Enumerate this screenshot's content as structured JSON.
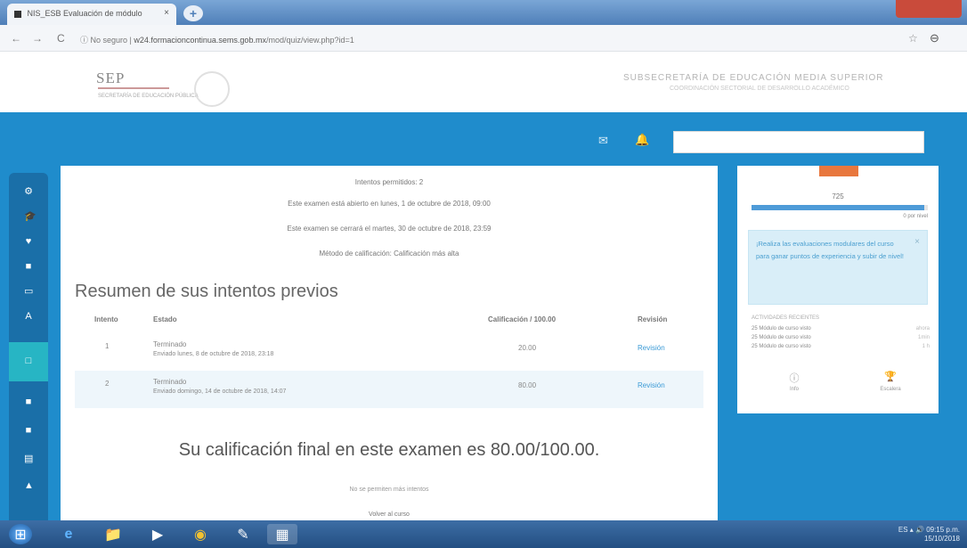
{
  "browser": {
    "tab_title": "NIS_ESB Evaluación de módulo",
    "tab_close": "×",
    "new_tab": "+",
    "back": "←",
    "forward": "→",
    "reload": "C",
    "url_security": "ⓘ No seguro",
    "url_host": "w24.formacioncontinua.sems.gob.mx",
    "url_path": "/mod/quiz/view.php?id=1",
    "star": "☆",
    "account": "⊖"
  },
  "header": {
    "logo_text": "SEP",
    "logo_sub": "SECRETARÍA DE EDUCACIÓN PÚBLICA",
    "title": "SUBSECRETARÍA DE EDUCACIÓN MEDIA SUPERIOR",
    "subtitle": "COORDINACIÓN SECTORIAL DE DESARROLLO ACADÉMICO"
  },
  "navbar": {
    "mail_icon": "✉",
    "bell_icon": "🔔",
    "search_placeholder": ""
  },
  "sidebar": {
    "icons": [
      "⚙",
      "🎓",
      "♥",
      "■",
      "▭",
      "A",
      "□",
      "■",
      "■",
      "▤",
      "▲"
    ]
  },
  "quiz": {
    "attempts_allowed": "Intentos permitidos: 2",
    "opened": "Este examen está abierto en lunes, 1 de octubre de 2018, 09:00",
    "closes": "Este examen se cerrará el martes, 30 de octubre de 2018, 23:59",
    "grading_method": "Método de calificación: Calificación más alta",
    "summary_title": "Resumen de sus intentos previos",
    "headers": {
      "attempt": "Intento",
      "status": "Estado",
      "grade": "Calificación / 100.00",
      "review": "Revisión"
    },
    "attempts": [
      {
        "number": "1",
        "status": "Terminado",
        "submitted": "Enviado lunes, 8 de octubre de 2018, 23:18",
        "grade": "20.00",
        "review": "Revisión"
      },
      {
        "number": "2",
        "status": "Terminado",
        "submitted": "Enviado domingo, 14 de octubre de 2018, 14:07",
        "grade": "80.00",
        "review": "Revisión"
      }
    ],
    "final_grade": "Su calificación final en este examen es 80.00/100.00.",
    "no_more_attempts": "No se permiten más intentos",
    "back_to_course": "Volver al curso"
  },
  "level_panel": {
    "level_label": "725",
    "progress_fraction": 0.98,
    "xp_label": "0 por nivel",
    "alert_text": "¡Realiza las evaluaciones modulares del curso para ganar puntos de experiencia y subir de nivel!",
    "alert_close": "×",
    "activity_title": "ACTIVIDADES RECIENTES",
    "activities": [
      {
        "text": "25 Módulo de curso visto",
        "time": "ahora"
      },
      {
        "text": "25 Módulo de curso visto",
        "time": "1min"
      },
      {
        "text": "25 Módulo de curso visto",
        "time": "1 h"
      }
    ],
    "info_icon": "ⓘ",
    "info_label": "Info",
    "ladder_icon": "🏆",
    "ladder_label": "Escalera"
  },
  "taskbar": {
    "start": "⊞",
    "icons": [
      "e",
      "📁",
      "▶",
      "◉",
      "✎",
      "▦"
    ],
    "tray_icons": "ES ▴ 🔊",
    "time": "09:15 p.m.",
    "date": "15/10/2018"
  },
  "colors": {
    "brand_blue": "#1f8ccc",
    "sidebar_blue": "#1a6fa8",
    "link": "#3a9ad6",
    "ribbon": "#e8773e"
  }
}
